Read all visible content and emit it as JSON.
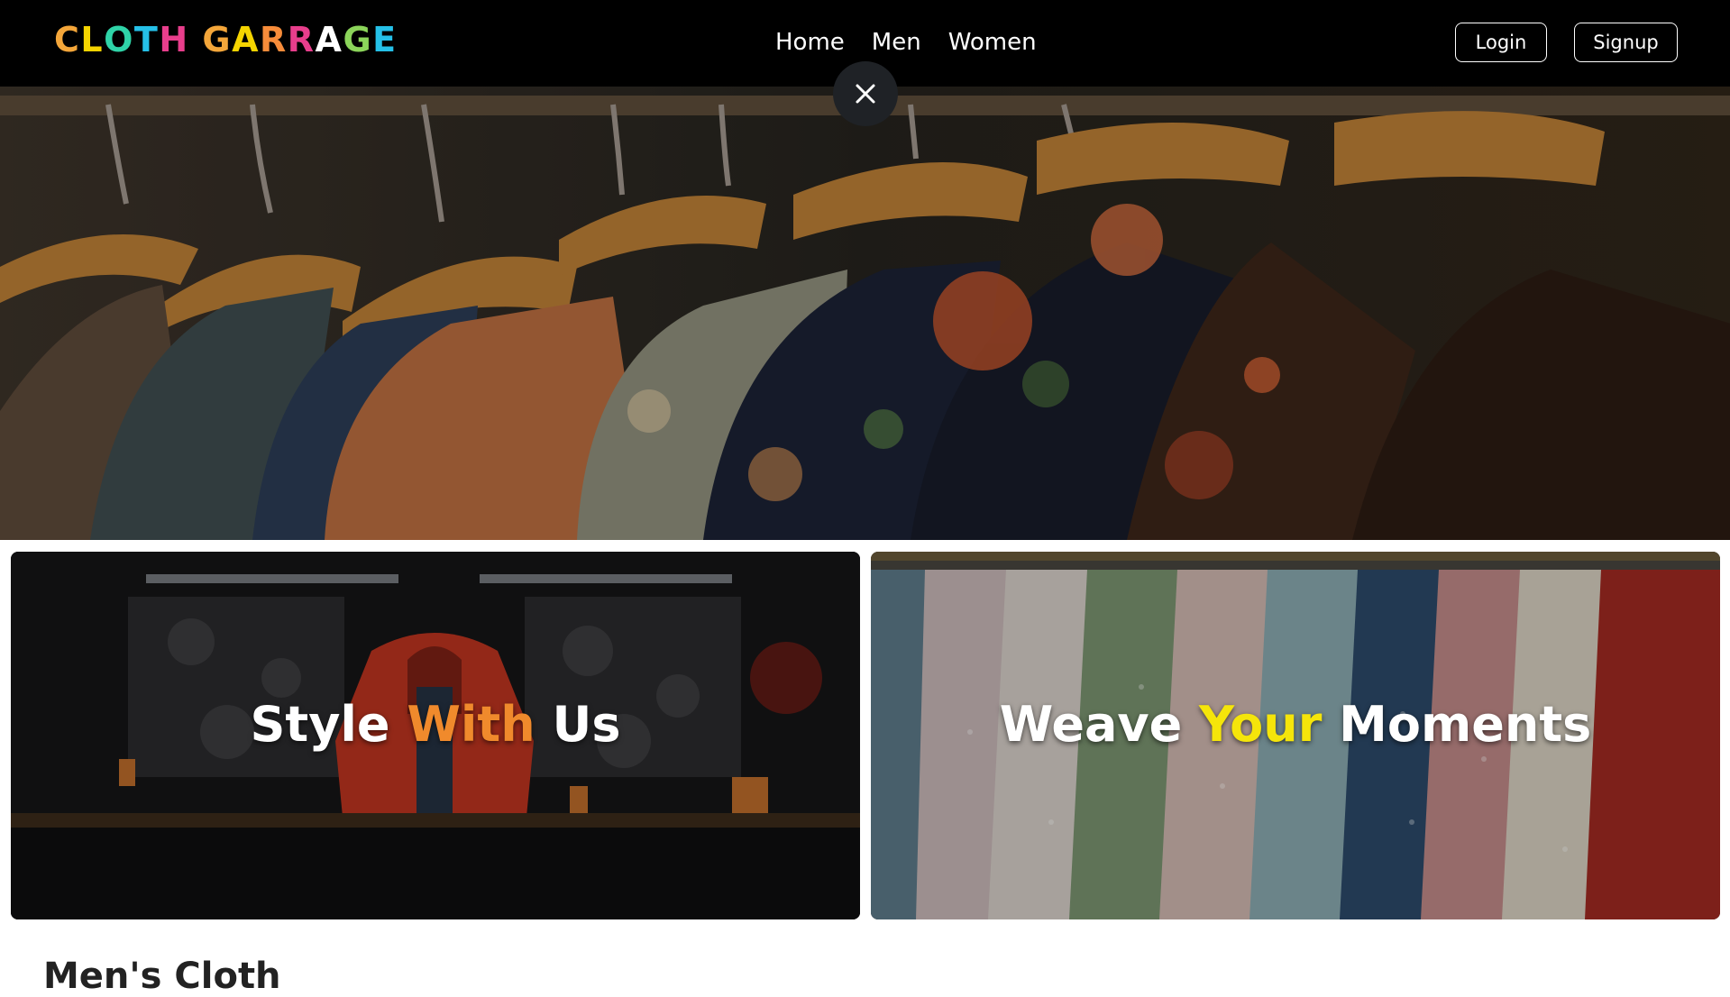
{
  "brand": {
    "name_letters": [
      {
        "char": "C",
        "color": "#f4a63a"
      },
      {
        "char": "L",
        "color": "#f5d400"
      },
      {
        "char": "O",
        "color": "#2fd4a8"
      },
      {
        "char": "T",
        "color": "#25c0e8"
      },
      {
        "char": "H",
        "color": "#e83e8c"
      },
      {
        "char": " ",
        "color": "#ffffff"
      },
      {
        "char": "G",
        "color": "#f4a63a"
      },
      {
        "char": "A",
        "color": "#f5d400"
      },
      {
        "char": "R",
        "color": "#f78c3a"
      },
      {
        "char": "R",
        "color": "#e83e8c"
      },
      {
        "char": "A",
        "color": "#ffffff"
      },
      {
        "char": "G",
        "color": "#8bd45a"
      },
      {
        "char": "E",
        "color": "#25c0e8"
      }
    ]
  },
  "nav": {
    "links": [
      "Home",
      "Men",
      "Women"
    ],
    "login_label": "Login",
    "signup_label": "Signup"
  },
  "close_icon": "close-icon",
  "cards": {
    "left": {
      "word1": "Style",
      "word2": "With",
      "word3": "Us",
      "accent_color": "#f08a2c"
    },
    "right": {
      "word1": "Weave",
      "word2": "Your",
      "word3": "Moments",
      "accent_color": "#f5e50a"
    }
  },
  "section": {
    "title": "Men's Cloth"
  }
}
